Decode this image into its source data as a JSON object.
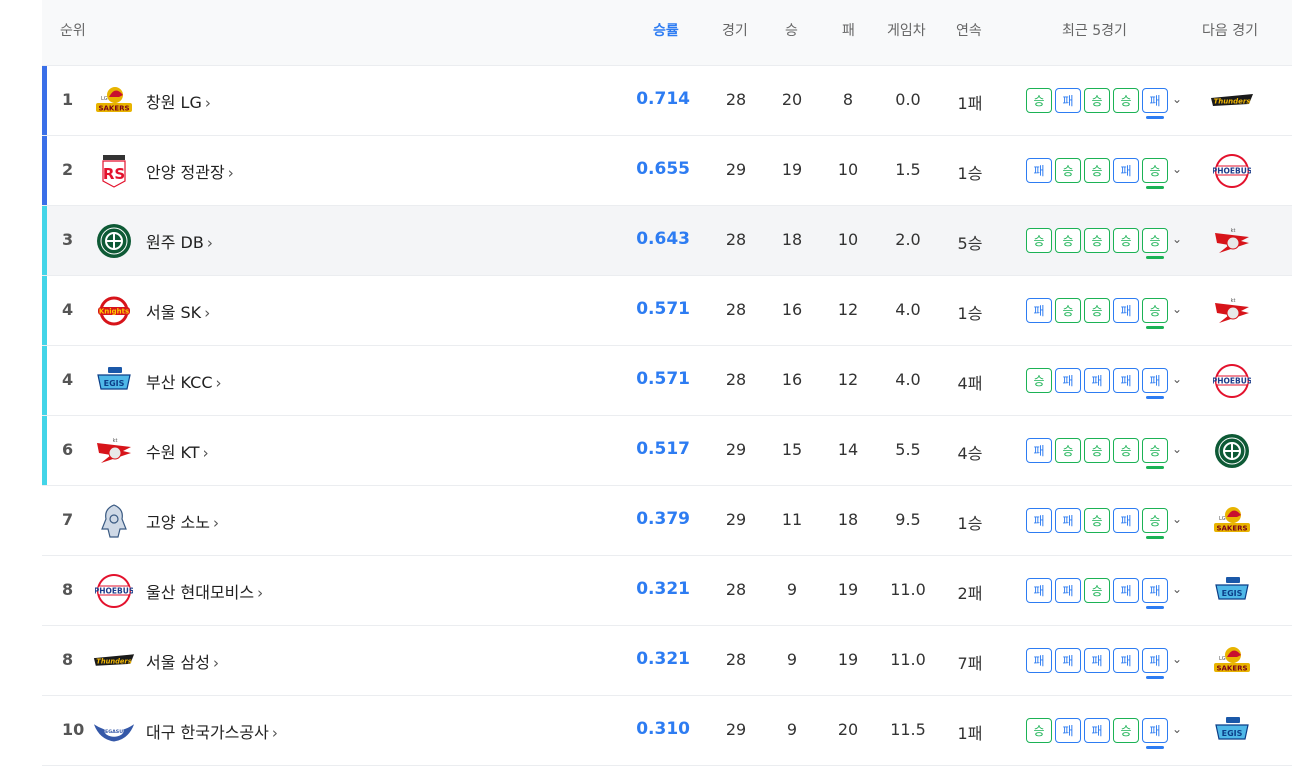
{
  "header": {
    "rank": "순위",
    "pct": "승률",
    "games": "경기",
    "wins": "승",
    "losses": "패",
    "gb": "게임차",
    "streak": "연속",
    "recent": "최근 5경기",
    "next": "다음 경기"
  },
  "colors": {
    "blue_bar": "#3a6fe8",
    "cyan_bar": "#43d5e8",
    "win": "#1bb255",
    "loss": "#2d7cf2"
  },
  "rows": [
    {
      "rank": "1",
      "team": "창원 LG",
      "logo": "lg-sakers",
      "pct": "0.714",
      "games": "28",
      "wins": "20",
      "losses": "8",
      "gb": "0.0",
      "streak": "1패",
      "recent": [
        "승",
        "패",
        "승",
        "승",
        "패"
      ],
      "next": "samsung-thunders",
      "bar": "blue"
    },
    {
      "rank": "2",
      "team": "안양 정관장",
      "logo": "anyang-redboosters",
      "pct": "0.655",
      "games": "29",
      "wins": "19",
      "losses": "10",
      "gb": "1.5",
      "streak": "1승",
      "recent": [
        "패",
        "승",
        "승",
        "패",
        "승"
      ],
      "next": "mobis-phoebus",
      "bar": "blue"
    },
    {
      "rank": "3",
      "team": "원주 DB",
      "logo": "db-promy",
      "pct": "0.643",
      "games": "28",
      "wins": "18",
      "losses": "10",
      "gb": "2.0",
      "streak": "5승",
      "recent": [
        "승",
        "승",
        "승",
        "승",
        "승"
      ],
      "next": "kt-sonicboom",
      "bar": "cyan"
    },
    {
      "rank": "4",
      "team": "서울 SK",
      "logo": "sk-knights",
      "pct": "0.571",
      "games": "28",
      "wins": "16",
      "losses": "12",
      "gb": "4.0",
      "streak": "1승",
      "recent": [
        "패",
        "승",
        "승",
        "패",
        "승"
      ],
      "next": "kt-sonicboom",
      "bar": "cyan"
    },
    {
      "rank": "4",
      "team": "부산 KCC",
      "logo": "kcc-egis",
      "pct": "0.571",
      "games": "28",
      "wins": "16",
      "losses": "12",
      "gb": "4.0",
      "streak": "4패",
      "recent": [
        "승",
        "패",
        "패",
        "패",
        "패"
      ],
      "next": "mobis-phoebus",
      "bar": "cyan"
    },
    {
      "rank": "6",
      "team": "수원 KT",
      "logo": "kt-sonicboom",
      "pct": "0.517",
      "games": "29",
      "wins": "15",
      "losses": "14",
      "gb": "5.5",
      "streak": "4승",
      "recent": [
        "패",
        "승",
        "승",
        "승",
        "승"
      ],
      "next": "db-promy",
      "bar": "cyan"
    },
    {
      "rank": "7",
      "team": "고양 소노",
      "logo": "sono-skygunners",
      "pct": "0.379",
      "games": "29",
      "wins": "11",
      "losses": "18",
      "gb": "9.5",
      "streak": "1승",
      "recent": [
        "패",
        "패",
        "승",
        "패",
        "승"
      ],
      "next": "lg-sakers",
      "bar": ""
    },
    {
      "rank": "8",
      "team": "울산 현대모비스",
      "logo": "mobis-phoebus",
      "pct": "0.321",
      "games": "28",
      "wins": "9",
      "losses": "19",
      "gb": "11.0",
      "streak": "2패",
      "recent": [
        "패",
        "패",
        "승",
        "패",
        "패"
      ],
      "next": "kcc-egis",
      "bar": ""
    },
    {
      "rank": "8",
      "team": "서울 삼성",
      "logo": "samsung-thunders",
      "pct": "0.321",
      "games": "28",
      "wins": "9",
      "losses": "19",
      "gb": "11.0",
      "streak": "7패",
      "recent": [
        "패",
        "패",
        "패",
        "패",
        "패"
      ],
      "next": "lg-sakers",
      "bar": ""
    },
    {
      "rank": "10",
      "team": "대구 한국가스공사",
      "logo": "kogas-pegasus",
      "pct": "0.310",
      "games": "29",
      "wins": "9",
      "losses": "20",
      "gb": "11.5",
      "streak": "1패",
      "recent": [
        "승",
        "패",
        "패",
        "승",
        "패"
      ],
      "next": "kcc-egis",
      "bar": ""
    }
  ]
}
